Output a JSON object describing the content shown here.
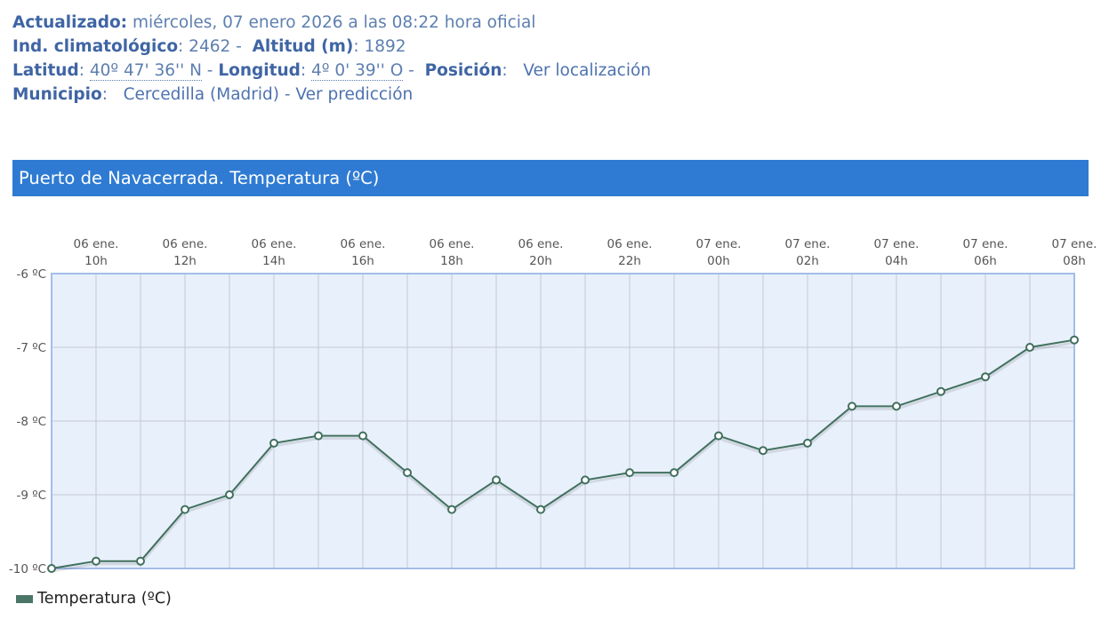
{
  "info": {
    "updated_label": "Actualizado:",
    "updated_value": "miércoles, 07 enero 2026 a las 08:22 hora oficial",
    "climate_label": "Ind. climatológico",
    "climate_value": "2462",
    "altitude_label": "Altitud (m)",
    "altitude_value": "1892",
    "lat_label": "Latitud",
    "lat_value": "40º 47' 36'' N",
    "lon_label": "Longitud",
    "lon_value": "4º 0' 39'' O",
    "pos_label": "Posición",
    "pos_link": "Ver localización",
    "mun_label": "Municipio",
    "mun_value": "Cercedilla (Madrid)",
    "mun_link": "Ver predicción"
  },
  "banner": {
    "title": "Puerto de Navacerrada. Temperatura (ºC)"
  },
  "legend": {
    "label": "Temperatura (ºC)"
  },
  "colors": {
    "line": "#41705e",
    "plot_bg": "#e8f0fb",
    "plot_border": "#a4bde8",
    "banner": "#2f7bd3"
  },
  "chart_data": {
    "type": "line",
    "ylim": [
      -10,
      -6
    ],
    "yticks": [
      -6,
      -7,
      -8,
      -9,
      -10
    ],
    "ytick_labels": [
      "-6 ºC",
      "-7 ºC",
      "-8 ºC",
      "-9 ºC",
      "-10 ºC"
    ],
    "x_labels": [
      [
        "06 ene.",
        "10h"
      ],
      [
        "06 ene.",
        "12h"
      ],
      [
        "06 ene.",
        "14h"
      ],
      [
        "06 ene.",
        "16h"
      ],
      [
        "06 ene.",
        "18h"
      ],
      [
        "06 ene.",
        "20h"
      ],
      [
        "06 ene.",
        "22h"
      ],
      [
        "07 ene.",
        "00h"
      ],
      [
        "07 ene.",
        "02h"
      ],
      [
        "07 ene.",
        "04h"
      ],
      [
        "07 ene.",
        "06h"
      ],
      [
        "07 ene.",
        "08h"
      ]
    ],
    "x": [
      "06 ene. 09h",
      "06 ene. 10h",
      "06 ene. 11h",
      "06 ene. 12h",
      "06 ene. 13h",
      "06 ene. 14h",
      "06 ene. 15h",
      "06 ene. 16h",
      "06 ene. 17h",
      "06 ene. 18h",
      "06 ene. 19h",
      "06 ene. 20h",
      "06 ene. 21h",
      "06 ene. 22h",
      "06 ene. 23h",
      "07 ene. 00h",
      "07 ene. 01h",
      "07 ene. 02h",
      "07 ene. 03h",
      "07 ene. 04h",
      "07 ene. 05h",
      "07 ene. 06h",
      "07 ene. 07h",
      "07 ene. 08h"
    ],
    "series": [
      {
        "name": "Temperatura (ºC)",
        "values": [
          -10,
          -9.9,
          -9.9,
          -9.2,
          -9.0,
          -8.3,
          -8.2,
          -8.2,
          -8.7,
          -9.2,
          -8.8,
          -9.2,
          -8.8,
          -8.7,
          -8.7,
          -8.2,
          -8.4,
          -8.3,
          -7.8,
          -7.8,
          -7.6,
          -7.4,
          -7.0,
          -6.9
        ]
      }
    ],
    "grid": true,
    "legend_position": "bottom-left"
  }
}
